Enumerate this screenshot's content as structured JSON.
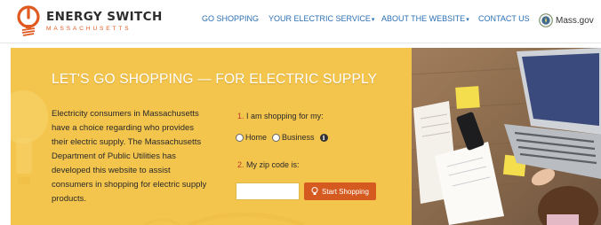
{
  "brand": {
    "name": "ENERGY SWITCH",
    "state": "MASSACHUSETTS",
    "accent": "#e05a1f"
  },
  "nav": {
    "items": [
      {
        "label": "GO SHOPPING",
        "has_dropdown": false
      },
      {
        "label": "YOUR ELECTRIC SERVICE",
        "has_dropdown": true
      },
      {
        "label": "ABOUT THE WEBSITE",
        "has_dropdown": true
      },
      {
        "label": "CONTACT US",
        "has_dropdown": false
      }
    ],
    "gov_link": "Mass.gov",
    "link_color": "#2b6fb3"
  },
  "hero": {
    "title": "LET'S GO SHOPPING — FOR ELECTRIC SUPPLY",
    "intro": "Electricity consumers in Massachusetts have a choice regarding who provides their electric supply. The Massachusetts Department of Public Utilities has developed this website to assist consumers in shopping for electric supply products.",
    "background": "#f4c54d",
    "step1": {
      "number": "1.",
      "label": "I am shopping for my:"
    },
    "options": [
      "Home",
      "Business"
    ],
    "step2": {
      "number": "2.",
      "label": "My zip code is:"
    },
    "zip_value": "",
    "button_label": "Start Shopping",
    "button_color": "#d45a1f"
  }
}
